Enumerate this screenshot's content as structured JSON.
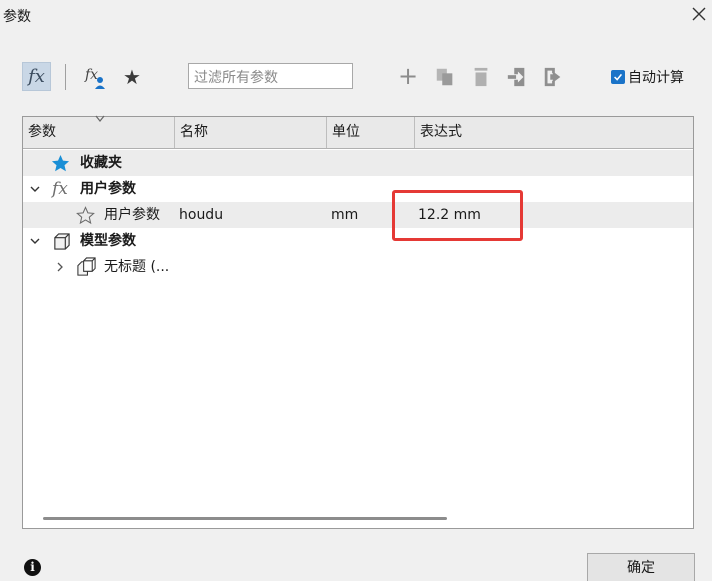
{
  "window": {
    "title": "参数"
  },
  "toolbar": {
    "fx_label": "fx",
    "filter_placeholder": "过滤所有参数",
    "auto_compute_label": "自动计算",
    "auto_compute_checked": true
  },
  "table": {
    "columns": [
      "参数",
      "名称",
      "单位",
      "表达式"
    ],
    "rows": [
      {
        "parameter": "收藏夹",
        "name": "",
        "unit": "",
        "expression": "",
        "icon": "star-filled-icon",
        "expanded": null
      },
      {
        "parameter": "用户参数",
        "name": "",
        "unit": "",
        "expression": "",
        "icon": "fx-icon",
        "expanded": true
      },
      {
        "parameter": "用户参数",
        "name": "houdu",
        "unit": "mm",
        "expression": "12.2 mm",
        "icon": "star-outline-icon",
        "expanded": null
      },
      {
        "parameter": "模型参数",
        "name": "",
        "unit": "",
        "expression": "",
        "icon": "cube-icon",
        "expanded": true
      },
      {
        "parameter": "无标题 (...",
        "name": "",
        "unit": "",
        "expression": "",
        "icon": "component-icon",
        "expanded": false
      }
    ]
  },
  "footer": {
    "ok_label": "确定"
  },
  "colors": {
    "accent": "#1a73c8",
    "highlight_box": "#e53935",
    "favorite_star": "#1a8fd6"
  }
}
